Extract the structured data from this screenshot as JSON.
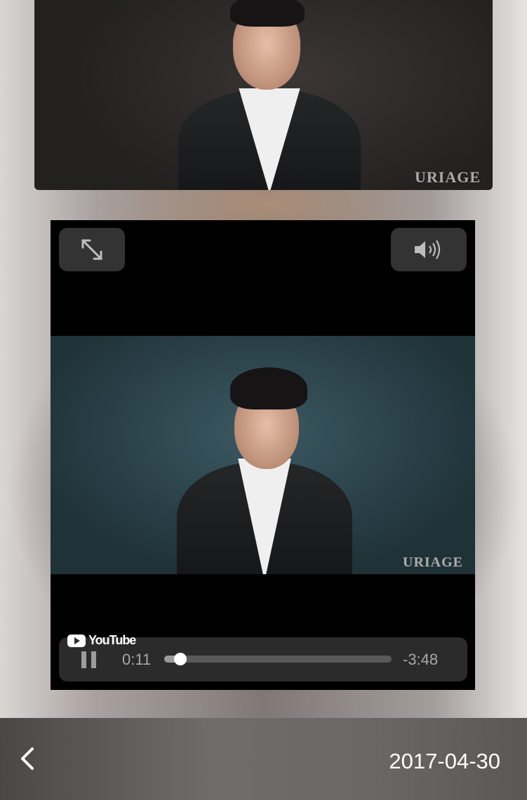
{
  "top_photo": {
    "watermark": "URIAGE"
  },
  "player": {
    "video_watermark": "URIAGE",
    "youtube_label": "YouTube",
    "elapsed": "0:11",
    "remaining": "-3:48",
    "progress_fraction": 0.07,
    "fullscreen_icon": "expand-arrows-icon",
    "volume_icon": "speaker-icon"
  },
  "bottom_bar": {
    "back_icon": "chevron-left-icon",
    "date": "2017-04-30"
  }
}
